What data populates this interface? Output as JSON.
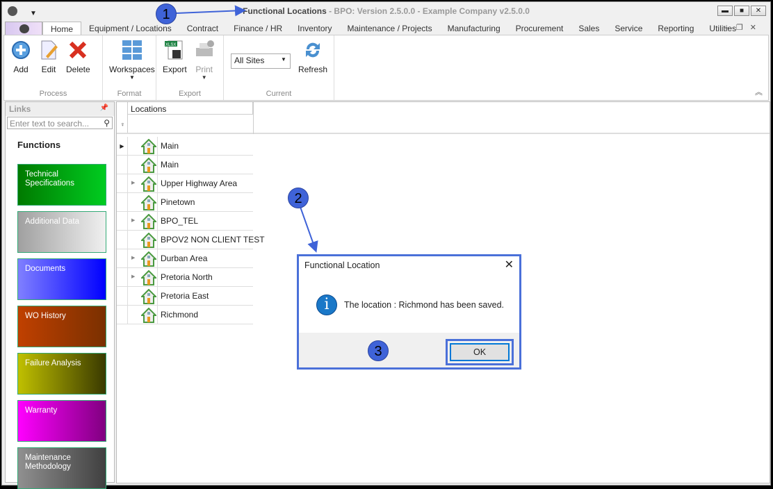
{
  "titlebar": {
    "title": "Functional Locations",
    "rest": " - BPO: Version 2.5.0.0 - Example Company v2.5.0.0"
  },
  "tabs": [
    "Home",
    "Equipment / Locations",
    "Contract",
    "Finance / HR",
    "Inventory",
    "Maintenance / Projects",
    "Manufacturing",
    "Procurement",
    "Sales",
    "Service",
    "Reporting",
    "Utilities"
  ],
  "ribbon": {
    "process": {
      "label": "Process",
      "add": "Add",
      "edit": "Edit",
      "delete": "Delete"
    },
    "format": {
      "label": "Format",
      "workspaces": "Workspaces"
    },
    "export": {
      "label": "Export",
      "export": "Export",
      "print": "Print",
      "xlsx": "XLSX"
    },
    "current": {
      "label": "Current",
      "site": "All Sites",
      "refresh": "Refresh"
    }
  },
  "links": {
    "title": "Links",
    "search_placeholder": "Enter text to search...",
    "functions": "Functions",
    "tiles": [
      {
        "label": "Technical Specifications",
        "from": "#007a00",
        "to": "#00cc20"
      },
      {
        "label": "Additional Data",
        "from": "#a0a0a0",
        "to": "#f0f0f0"
      },
      {
        "label": "Documents",
        "from": "#8080ff",
        "to": "#0000ff"
      },
      {
        "label": "WO History",
        "from": "#c04000",
        "to": "#7a3000"
      },
      {
        "label": "Failure Analysis",
        "from": "#c0c000",
        "to": "#3a3a00"
      },
      {
        "label": "Warranty",
        "from": "#ff00ff",
        "to": "#800080"
      },
      {
        "label": "Maintenance Methodology",
        "from": "#909090",
        "to": "#404040"
      }
    ]
  },
  "grid": {
    "header": "Locations",
    "rows": [
      {
        "name": "Main",
        "expandable": false,
        "current": true
      },
      {
        "name": "Main",
        "expandable": false
      },
      {
        "name": "Upper Highway Area",
        "expandable": true
      },
      {
        "name": "Pinetown",
        "expandable": false
      },
      {
        "name": "BPO_TEL",
        "expandable": true
      },
      {
        "name": "BPOV2 NON CLIENT TEST",
        "expandable": false
      },
      {
        "name": "Durban Area",
        "expandable": true
      },
      {
        "name": "Pretoria North",
        "expandable": true
      },
      {
        "name": "Pretoria East",
        "expandable": false
      },
      {
        "name": "Richmond",
        "expandable": false
      }
    ]
  },
  "dialog": {
    "title": "Functional Location",
    "message": "The location : Richmond has been saved.",
    "ok": "OK"
  },
  "callouts": [
    "1",
    "2",
    "3"
  ]
}
